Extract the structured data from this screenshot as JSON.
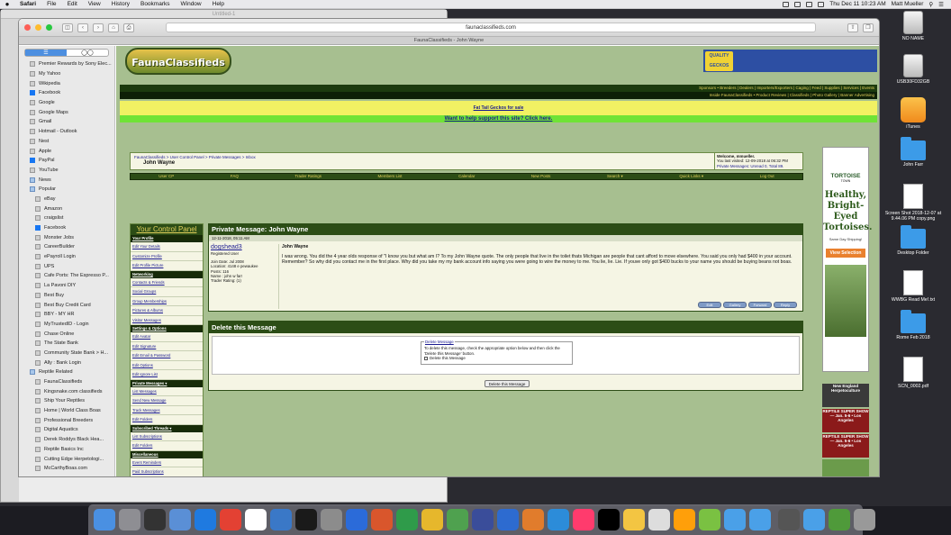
{
  "menubar": {
    "app": "Safari",
    "items": [
      "File",
      "Edit",
      "View",
      "History",
      "Bookmarks",
      "Window",
      "Help"
    ],
    "datetime": "Thu Dec 11  10:23 AM",
    "user": "Matt Mueller"
  },
  "bg_window": {
    "title": "Untitled-1"
  },
  "browser": {
    "url": "faunaclassifieds.com",
    "tab": "FaunaClassifieds - John Wayne"
  },
  "sidebar": {
    "items": [
      {
        "label": "Premier Rewards by Sony Elec...",
        "icon": "page"
      },
      {
        "label": "My Yahoo",
        "icon": "page"
      },
      {
        "label": "Wikipedia",
        "icon": "page"
      },
      {
        "label": "Facebook",
        "icon": "facebook"
      },
      {
        "label": "Google",
        "icon": "google"
      },
      {
        "label": "Google Maps",
        "icon": "page"
      },
      {
        "label": "Gmail",
        "icon": "page"
      },
      {
        "label": "Hotmail - Outlook",
        "icon": "page"
      },
      {
        "label": "Nest",
        "icon": "page"
      },
      {
        "label": "Apple",
        "icon": "page"
      },
      {
        "label": "PayPal",
        "icon": "paypal"
      },
      {
        "label": "YouTube",
        "icon": "page"
      },
      {
        "label": "News",
        "icon": "folder"
      },
      {
        "label": "Popular",
        "icon": "folder"
      },
      {
        "label": "eBay",
        "icon": "page"
      },
      {
        "label": "Amazon",
        "icon": "page"
      },
      {
        "label": "craigslist",
        "icon": "page"
      },
      {
        "label": "Facebook",
        "icon": "facebook"
      },
      {
        "label": "Monster Jobs",
        "icon": "page"
      },
      {
        "label": "CareerBuilder",
        "icon": "page"
      },
      {
        "label": "ePayroll Login",
        "icon": "page"
      },
      {
        "label": "UPS",
        "icon": "page"
      },
      {
        "label": "Cafe Ports: The Espresso P...",
        "icon": "page"
      },
      {
        "label": "La Pavoni DIY",
        "icon": "page"
      },
      {
        "label": "Best Buy",
        "icon": "page"
      },
      {
        "label": "Best Buy Credit Card",
        "icon": "page"
      },
      {
        "label": "BBY - MY HR",
        "icon": "page"
      },
      {
        "label": "MyTrustedID - Login",
        "icon": "page"
      },
      {
        "label": "Chase Online",
        "icon": "page"
      },
      {
        "label": "The State Bank",
        "icon": "page"
      },
      {
        "label": "Community State Bank > H...",
        "icon": "page"
      },
      {
        "label": "Ally : Bank Login",
        "icon": "page"
      },
      {
        "label": "Reptile Related",
        "icon": "folder"
      },
      {
        "label": "FaunaClassifieds",
        "icon": "page"
      },
      {
        "label": "Kingsnake.com classifieds",
        "icon": "page"
      },
      {
        "label": "Ship Your Reptiles",
        "icon": "page"
      },
      {
        "label": "Home | World Class Boas",
        "icon": "page"
      },
      {
        "label": "Professional Breeders",
        "icon": "page"
      },
      {
        "label": "Digital Aquatics",
        "icon": "page"
      },
      {
        "label": "Derek Roddys Black Hea...",
        "icon": "page"
      },
      {
        "label": "Reptile Basics Inc",
        "icon": "page"
      },
      {
        "label": "Cutting Edge Herpetologi...",
        "icon": "page"
      },
      {
        "label": "McCarthyBoas.com",
        "icon": "page"
      }
    ]
  },
  "site": {
    "logo": "FaunaClassifieds",
    "ad_text": "QUALITY GECKOS",
    "nav1": "Sponsors  •  Breeders | Dealers | Importers/Exporters | Caging | Feed | Supplies | Services | Events",
    "nav2": "Inside FaunaClassifieds • Product Reviews | Classifieds | Photo Gallery | Banner Advertising",
    "yellow_link": "Fat Tail Geckos for sale",
    "green_link": "Want to help support this site? Click here.",
    "breadcrumb": "FaunaClassifieds > User Control Panel > Private Messages > Inbox",
    "page_title": "John Wayne",
    "welcome": "Welcome, mmueller.",
    "last_visited": "You last visited: 12-09-2018 at 06:32 PM",
    "pm_count": "Private Messages: Unread 0, Total 89.",
    "log_out": "Log Out",
    "usernav": [
      "User CP",
      "FAQ",
      "Trader Ratings",
      "Members List",
      "Calendar",
      "New Posts",
      "Search ▾",
      "Quick Links ▾",
      "Log Out"
    ]
  },
  "ucp": {
    "title": "Your Control Panel",
    "sections": [
      {
        "header": "Your Profile",
        "items": [
          "Edit Your Details",
          "Customize Profile",
          "Edit Profile Picture"
        ]
      },
      {
        "header": "Networking",
        "items": [
          "Contacts & Friends",
          "Social Groups",
          "Group Memberships",
          "Pictures & Albums",
          "Visitor Messages"
        ]
      },
      {
        "header": "Settings & Options",
        "items": [
          "Edit Avatar",
          "Edit Signature",
          "Edit Email & Password",
          "Edit Options",
          "Edit Ignore List"
        ]
      },
      {
        "header": "Private Messages ▾",
        "items": [
          "List Messages",
          "Send New Message",
          "Track Messages",
          "Edit Folders"
        ]
      },
      {
        "header": "Subscribed Threads ▾",
        "items": [
          "List Subscriptions",
          "Edit Folders"
        ]
      },
      {
        "header": "Miscellaneous",
        "items": [
          "Event Reminders",
          "Paid Subscriptions",
          "Attachments"
        ]
      }
    ]
  },
  "pm": {
    "title": "Private Message: John Wayne",
    "date": "12-11-2018, 05:11 AM",
    "user": "dogshead3",
    "role": "Registered User",
    "join": "Join Date: Jul 2008",
    "location": "Location: 4148 e pewaukee",
    "posts": "Posts: 116",
    "name": "Name : john w farr",
    "trader": "Trader Rating: (1)",
    "subject": "John Wayne",
    "body": "I was wrong. You did the 4 year olds response of \"I know you but what am I? To my John Wayne quote. The only people that live in the toilet thats Michigan are people that cant afford to move elsewhere. You said you only had $400 in your account. Remember? So why did you contact me in the first place. Why did you take my my bank account info saying you were going to wire the money to me. You lie, lie. Lie. If youve only got $400 bucks to your name you should be buying beans not boas.",
    "buttons": [
      "Edit",
      "Gallery",
      "Forward",
      "Reply"
    ]
  },
  "delete": {
    "title": "Delete this Message",
    "legend": "Delete Message",
    "text": "To delete this message, check the appropriate option below and then click the 'Delete this Message' button.",
    "checkbox": "Delete this Message",
    "button": "Delete this Message"
  },
  "skyad": {
    "brand": "TORTOISE",
    "sub": "TOWN",
    "headline": "Healthy, Bright-Eyed Tortoises.",
    "ship": "Same Day Shipping!",
    "cta": "View Selection"
  },
  "small_ads": [
    "New England Herpetoculture",
    "REPTILE SUPER SHOW — Jan. 5-6 • Los Angeles",
    "REPTILE SUPER SHOW — Jan. 5-6 • Los Angeles"
  ],
  "desktop": [
    {
      "label": "NO NAME",
      "type": "drive"
    },
    {
      "label": "USB30FD32GB",
      "type": "drive"
    },
    {
      "label": "iTunes",
      "type": "itunes"
    },
    {
      "label": "John Farr",
      "type": "folder"
    },
    {
      "label": "Screen Shot 2018-12-07 at 9.44.06 PM copy.png",
      "type": "paper"
    },
    {
      "label": "Desktop Folder",
      "type": "folder"
    },
    {
      "label": "WWBG Read Me!.txt",
      "type": "paper"
    },
    {
      "label": "Rome Feb 2018",
      "type": "folder"
    },
    {
      "label": "SCN_0002.pdf",
      "type": "paper"
    }
  ],
  "dock": {
    "colors": [
      "#4a90e2",
      "#8e8e93",
      "#333",
      "#5a8fd6",
      "#1f7ae0",
      "#e34133",
      "#fff",
      "#3a78c7",
      "#1a1a1a",
      "#8c8c8c",
      "#2b6bd9",
      "#d9562c",
      "#2f9b4a",
      "#e6b72c",
      "#4fa14f",
      "#3a4d9a",
      "#2d6bd0",
      "#e17c2c",
      "#2c8cd9",
      "#ff3b6d",
      "#000",
      "#f3c542",
      "#ddd",
      "#ff9f0a",
      "#7ac142",
      "#4aa0e8",
      "#4aa0e8",
      "#555",
      "#4aa0e8",
      "#4f9a3a",
      "#999"
    ]
  }
}
